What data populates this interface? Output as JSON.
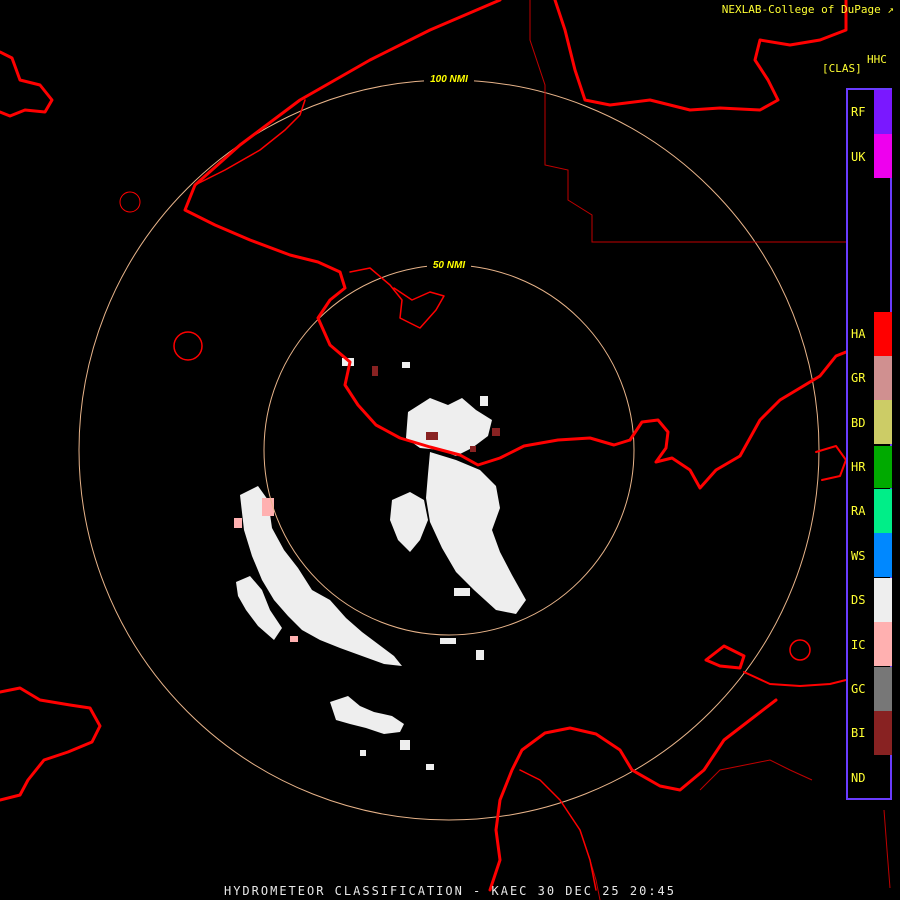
{
  "header": {
    "credit": "NEXLAB-College of DuPage",
    "credit_icon": "external-link-icon",
    "product_code": "HHC"
  },
  "range_rings": {
    "color": "#e8b48a",
    "label_color": "#ffff00",
    "labels": [
      "100 NMI",
      "50 NMI"
    ]
  },
  "map_colors": {
    "coastline": "#ff0000",
    "borders": "#c00000"
  },
  "legend": {
    "title": "[CLAS]",
    "border_color": "#6a3cff",
    "items": [
      {
        "code": "RF",
        "color": "#7a18ff"
      },
      {
        "code": "UK",
        "color": "#ee00ee"
      },
      {
        "code": "HA",
        "color": "#ff0000"
      },
      {
        "code": "GR",
        "color": "#d09090"
      },
      {
        "code": "BD",
        "color": "#cccc66"
      },
      {
        "code": "HR",
        "color": "#00aa00"
      },
      {
        "code": "RA",
        "color": "#00ee88"
      },
      {
        "code": "WS",
        "color": "#0088ff"
      },
      {
        "code": "DS",
        "color": "#eeeeee"
      },
      {
        "code": "IC",
        "color": "#ffb0b0"
      },
      {
        "code": "GC",
        "color": "#777777"
      },
      {
        "code": "BI",
        "color": "#882222"
      },
      {
        "code": "ND",
        "color": ""
      }
    ]
  },
  "footer": {
    "title": "HYDROMETEOR CLASSIFICATION - KAEC 30 DEC 25 20:45"
  }
}
